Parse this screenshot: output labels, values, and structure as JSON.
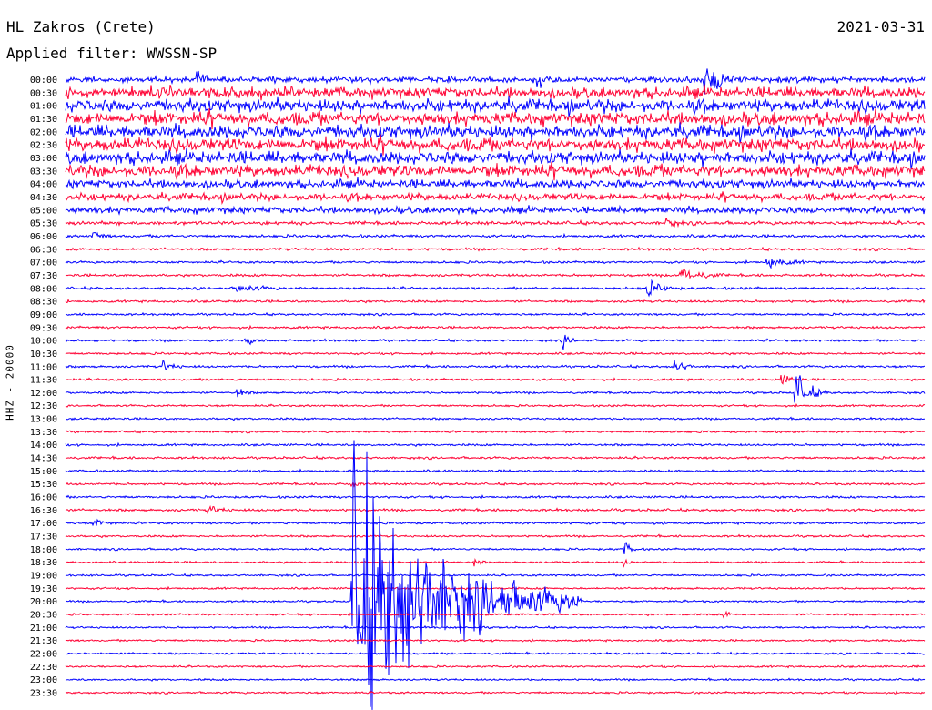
{
  "header": {
    "station": "HL Zakros (Crete)",
    "date": "2021-03-31",
    "filter": "Applied filter: WWSSN-SP",
    "channel": "HHZ - 20000"
  },
  "colors": {
    "odd_trace": "#0000ff",
    "even_trace": "#ff0033",
    "background": "#ffffff",
    "text": "#000000"
  },
  "chart_data": {
    "type": "line",
    "title": "HL Zakros (Crete)",
    "subtitle": "Applied filter: WWSSN-SP",
    "ylabel": "HHZ - 20000",
    "trace_minutes": 30,
    "time_labels": [
      "00:00",
      "00:30",
      "01:00",
      "01:30",
      "02:00",
      "02:30",
      "03:00",
      "03:30",
      "04:00",
      "04:30",
      "05:00",
      "05:30",
      "06:00",
      "06:30",
      "07:00",
      "07:30",
      "08:00",
      "08:30",
      "09:00",
      "09:30",
      "10:00",
      "10:30",
      "11:00",
      "11:30",
      "12:00",
      "12:30",
      "13:00",
      "13:30",
      "14:00",
      "14:30",
      "15:00",
      "15:30",
      "16:00",
      "16:30",
      "17:00",
      "17:30",
      "18:00",
      "18:30",
      "19:00",
      "19:30",
      "20:00",
      "20:30",
      "21:00",
      "21:30",
      "22:00",
      "22:30",
      "23:00",
      "23:30"
    ],
    "noise_level": [
      0.35,
      0.8,
      0.95,
      1.0,
      1.0,
      1.0,
      0.95,
      0.9,
      0.6,
      0.5,
      0.45,
      0.18,
      0.12,
      0.1,
      0.08,
      0.1,
      0.1,
      0.08,
      0.07,
      0.08,
      0.08,
      0.07,
      0.08,
      0.07,
      0.07,
      0.06,
      0.06,
      0.06,
      0.07,
      0.08,
      0.07,
      0.07,
      0.08,
      0.1,
      0.08,
      0.06,
      0.06,
      0.05,
      0.05,
      0.05,
      0.05,
      0.05,
      0.05,
      0.05,
      0.05,
      0.05,
      0.05,
      0.05
    ],
    "events": [
      {
        "trace": 0,
        "minute": 22.3,
        "amplitude": 6.0,
        "duration": 1.5
      },
      {
        "trace": 0,
        "minute": 16.5,
        "amplitude": 3.0,
        "duration": 0.5
      },
      {
        "trace": 0,
        "minute": 4.6,
        "amplitude": 2.5,
        "duration": 0.4
      },
      {
        "trace": 11,
        "minute": 21.0,
        "amplitude": 1.6,
        "duration": 0.6
      },
      {
        "trace": 12,
        "minute": 1.0,
        "amplitude": 1.4,
        "duration": 0.6
      },
      {
        "trace": 14,
        "minute": 24.5,
        "amplitude": 1.4,
        "duration": 1.5
      },
      {
        "trace": 15,
        "minute": 21.5,
        "amplitude": 2.2,
        "duration": 1.5
      },
      {
        "trace": 16,
        "minute": 20.3,
        "amplitude": 2.0,
        "duration": 1.2
      },
      {
        "trace": 16,
        "minute": 6.0,
        "amplitude": 1.2,
        "duration": 1.5
      },
      {
        "trace": 20,
        "minute": 17.4,
        "amplitude": 1.6,
        "duration": 0.6
      },
      {
        "trace": 20,
        "minute": 6.4,
        "amplitude": 1.3,
        "duration": 0.4
      },
      {
        "trace": 22,
        "minute": 21.3,
        "amplitude": 2.2,
        "duration": 0.7
      },
      {
        "trace": 22,
        "minute": 3.4,
        "amplitude": 1.3,
        "duration": 0.8
      },
      {
        "trace": 23,
        "minute": 25.0,
        "amplitude": 1.3,
        "duration": 0.8
      },
      {
        "trace": 24,
        "minute": 25.5,
        "amplitude": 4.5,
        "duration": 1.2
      },
      {
        "trace": 24,
        "minute": 6.0,
        "amplitude": 1.3,
        "duration": 0.6
      },
      {
        "trace": 31,
        "minute": 10.0,
        "amplitude": 1.1,
        "duration": 0.4
      },
      {
        "trace": 33,
        "minute": 5.0,
        "amplitude": 1.0,
        "duration": 1.0
      },
      {
        "trace": 34,
        "minute": 1.0,
        "amplitude": 1.0,
        "duration": 1.0
      },
      {
        "trace": 36,
        "minute": 19.5,
        "amplitude": 2.3,
        "duration": 0.5
      },
      {
        "trace": 37,
        "minute": 14.3,
        "amplitude": 1.2,
        "duration": 0.4
      },
      {
        "trace": 37,
        "minute": 19.5,
        "amplitude": 1.0,
        "duration": 0.4
      },
      {
        "trace": 41,
        "minute": 23.0,
        "amplitude": 1.0,
        "duration": 0.5
      },
      {
        "trace": 40,
        "minute": 10.0,
        "amplitude": 32.0,
        "duration": 8.0
      }
    ]
  }
}
